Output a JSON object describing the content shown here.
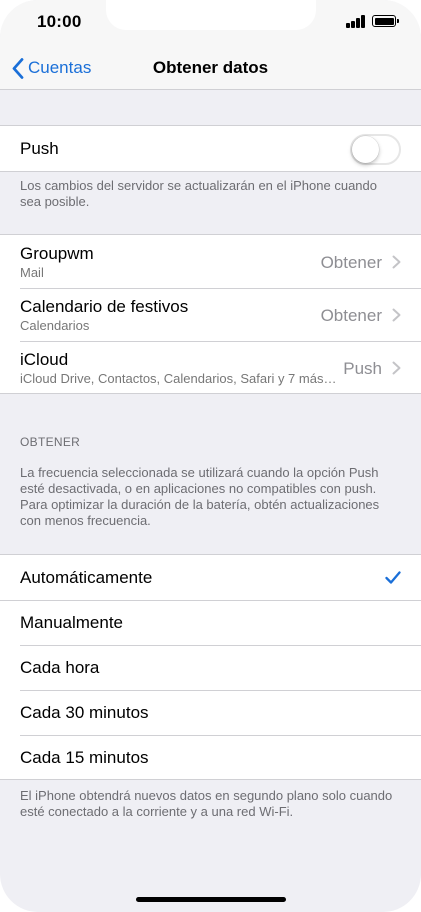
{
  "status_bar": {
    "time": "10:00"
  },
  "nav": {
    "back_label": "Cuentas",
    "title": "Obtener datos"
  },
  "push": {
    "label": "Push",
    "enabled": false
  },
  "push_footnote": "Los cambios del servidor se actualizarán en el iPhone cuando sea posible.",
  "accounts": [
    {
      "name": "Groupwm",
      "type": "Mail",
      "value": "Obtener"
    },
    {
      "name": "Calendario de festivos",
      "type": "Calendarios",
      "value": "Obtener"
    },
    {
      "name": "iCloud",
      "type": "iCloud Drive, Contactos, Calendarios, Safari y 7 más…",
      "value": "Push"
    }
  ],
  "fetch_section": {
    "header": "OBTENER",
    "description": "La frecuencia seleccionada se utilizará cuando la opción Push esté desactivada, o en aplicaciones no compatibles con push. Para optimizar la duración de la batería, obtén actualizaciones con menos frecuencia."
  },
  "fetch_options": [
    {
      "label": "Automáticamente",
      "selected": true
    },
    {
      "label": "Manualmente",
      "selected": false
    },
    {
      "label": "Cada hora",
      "selected": false
    },
    {
      "label": "Cada 30 minutos",
      "selected": false
    },
    {
      "label": "Cada 15 minutos",
      "selected": false
    }
  ],
  "bottom_footnote": "El iPhone obtendrá nuevos datos en segundo plano solo cuando esté conectado a la corriente y a una red Wi-Fi.",
  "colors": {
    "accent": "#1a6fd8",
    "background": "#efeff4",
    "separator": "#d0d0d4"
  }
}
